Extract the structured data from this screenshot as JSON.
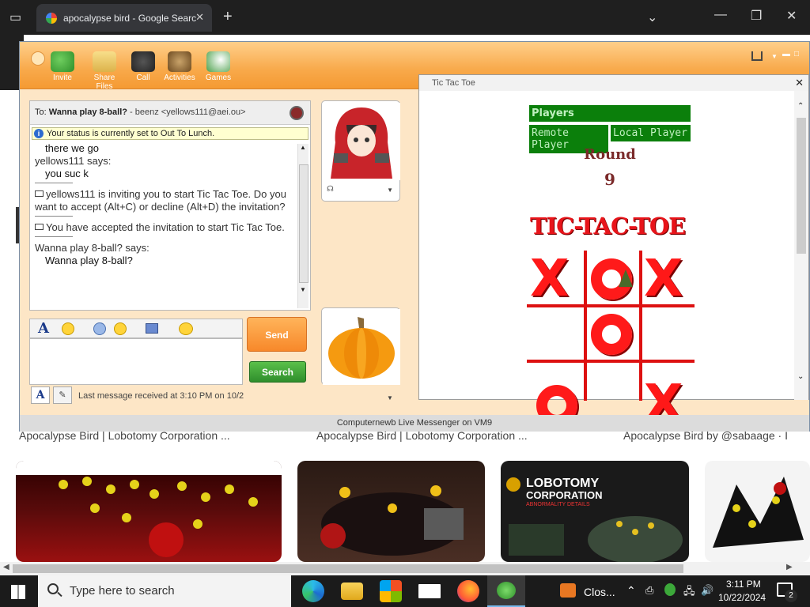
{
  "browser": {
    "tab_title": "apocalypse bird - Google Searc",
    "tab_close": "✕",
    "new_tab": "+"
  },
  "background_page": {
    "captions": [
      "Apocalypse Bird | Lobotomy Corporation ...",
      "Apocalypse Bird | Lobotomy Corporation ...",
      "Apocalypse Bird by @sabaage · I"
    ],
    "thumb_text": [
      "LOBOTOMY",
      "CORPORATION",
      "ABNORMALITY DETAILS"
    ]
  },
  "messenger": {
    "toolbar": [
      {
        "label": "Invite",
        "icon": "invite-icon"
      },
      {
        "label": "Share Files",
        "icon": "folder-icon"
      },
      {
        "label": "Call",
        "icon": "phone-icon"
      },
      {
        "label": "Activities",
        "icon": "activities-icon"
      },
      {
        "label": "Games",
        "icon": "games-icon"
      }
    ],
    "to_label": "To:",
    "to_name": "Wanna play 8-ball?",
    "to_rest": "- beenz <yellows111@aei.ou>",
    "status_notice": "Your status is currently set to Out To Lunch.",
    "chat": {
      "line1": "there we go",
      "line2": "yellows111 says:",
      "line3": "you suc k",
      "invite_msg": "yellows111 is inviting you to start Tic Tac Toe. Do you want to accept (Alt+C) or decline (Alt+D) the invitation?",
      "accepted_msg": "You have accepted the invitation to start Tic Tac Toe.",
      "says": "Wanna play 8-ball? says:",
      "last": "Wanna play 8-ball?"
    },
    "send_label": "Send",
    "search_label": "Search",
    "last_message": "Last message received at 3:10 PM on 10/2",
    "footer": "Computernewb Live Messenger on VM9"
  },
  "tictactoe": {
    "title": "Tic Tac Toe",
    "close": "✕",
    "players_header": "Players",
    "remote_player": "Remote Player",
    "local_player": "Local Player",
    "round_label": "Round",
    "round_value": "9",
    "logo": "TIC-TAC-TOE",
    "board": [
      "X",
      "O",
      "X",
      "",
      "O",
      "",
      "O",
      "",
      "X"
    ]
  },
  "taskbar": {
    "search_placeholder": "Type here to search",
    "active_app_label": "Clos...",
    "time": "3:11 PM",
    "date": "10/22/2024",
    "notification_count": "2"
  }
}
